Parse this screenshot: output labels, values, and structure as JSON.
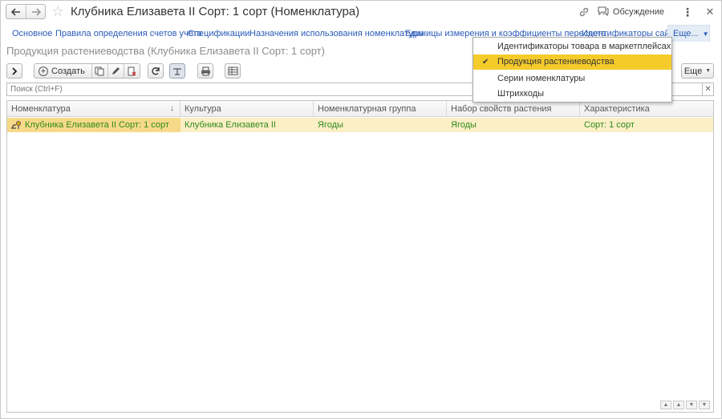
{
  "window": {
    "title": "Клубника Елизавета II Сорт: 1 сорт (Номенклатура)",
    "discussion_label": "Обсуждение"
  },
  "nav_links": [
    "Основное",
    "Правила определения счетов учета",
    "Спецификации",
    "Назначения использования номенклатуры",
    "Единицы измерения и коэффициенты пересчета",
    "Идентификаторы сайта"
  ],
  "more_label": "Еще...",
  "dropdown": {
    "items": [
      {
        "label": "Идентификаторы товара в маркетплейсах",
        "selected": false
      },
      {
        "label": "Продукция растениеводства",
        "selected": true
      },
      {
        "label": "Серии номенклатуры",
        "selected": false
      },
      {
        "label": "Штрихкоды",
        "selected": false
      }
    ]
  },
  "page_subtitle": "Продукция растениеводства (Клубника Елизавета II Сорт: 1 сорт)",
  "toolbar": {
    "create_label": "Создать",
    "more_label": "Еще"
  },
  "search": {
    "placeholder": "Поиск (Ctrl+F)"
  },
  "table": {
    "columns": [
      "Номенклатура",
      "Культура",
      "Номенклатурная группа",
      "Набор свойств растения",
      "Характеристика"
    ],
    "sort_indicator": "↓",
    "rows": [
      [
        "Клубника Елизавета II Сорт: 1 сорт",
        "Клубника Елизавета II",
        "Ягоды",
        "Ягоды",
        "Сорт: 1 сорт"
      ]
    ]
  },
  "colors": {
    "link": "#2a5bb8",
    "row_text": "#2f8a1d",
    "row_bg": "#fbefc5",
    "selected_cell_bg": "#f7d98a",
    "menu_selected": "#f5cb2b"
  }
}
